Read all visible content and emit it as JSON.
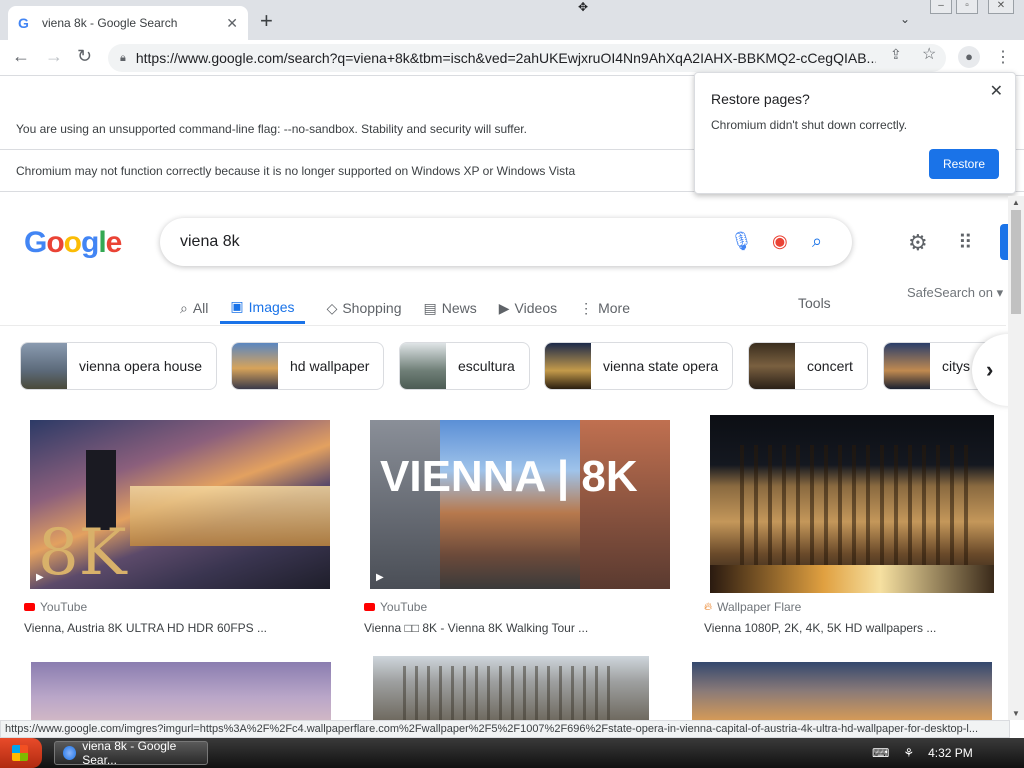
{
  "browser": {
    "tab_title": "viena 8k - Google Search",
    "tab_favicon": "G",
    "new_tab": "+",
    "url": "https://www.google.com/search?q=viena+8k&tbm=isch&ved=2ahUKEwjxruOI4Nn9AhXqA2IAHX-BBKMQ2-cCegQIAB...",
    "status_url": "https://www.google.com/imgres?imgurl=https%3A%2F%2Fc4.wallpaperflare.com%2Fwallpaper%2F5%2F1007%2F696%2Fstate-opera-in-vienna-capital-of-austria-4k-ultra-hd-wallpaper-for-desktop-l..."
  },
  "infobars": [
    "You are using an unsupported command-line flag: --no-sandbox. Stability and security will suffer.",
    "Chromium may not function correctly because it is no longer supported on Windows XP or Windows Vista"
  ],
  "restore_popup": {
    "title": "Restore pages?",
    "message": "Chromium didn't shut down correctly.",
    "button": "Restore"
  },
  "google": {
    "logo": [
      "G",
      "o",
      "o",
      "g",
      "l",
      "e"
    ],
    "query": "viena 8k",
    "tabs": [
      {
        "label": "All",
        "icon": "search-icon"
      },
      {
        "label": "Images",
        "icon": "image-icon",
        "active": true
      },
      {
        "label": "Shopping",
        "icon": "tag-icon"
      },
      {
        "label": "News",
        "icon": "news-icon"
      },
      {
        "label": "Videos",
        "icon": "play-icon"
      },
      {
        "label": "More",
        "icon": "more-icon"
      }
    ],
    "tools": "Tools",
    "safesearch": "SafeSearch on",
    "chips": [
      "vienna opera house",
      "hd wallpaper",
      "escultura",
      "vienna state opera",
      "concert",
      "citys"
    ]
  },
  "results": [
    {
      "source": "YouTube",
      "title": "Vienna, Austria 8K ULTRA HD HDR 60FPS ...",
      "overlay": "8K"
    },
    {
      "source": "YouTube",
      "title": "Vienna □□ 8K - Vienna 8K Walking Tour ...",
      "overlay": "VIENNA | 8K"
    },
    {
      "source": "Wallpaper Flare",
      "title": "Vienna 1080P, 2K, 4K, 5K HD wallpapers ..."
    }
  ],
  "taskbar": {
    "task_label": "viena 8k - Google Sear...",
    "clock": "4:32 PM"
  },
  "colors": {
    "accent": "#1a73e8",
    "youtube": "#ff0000"
  }
}
